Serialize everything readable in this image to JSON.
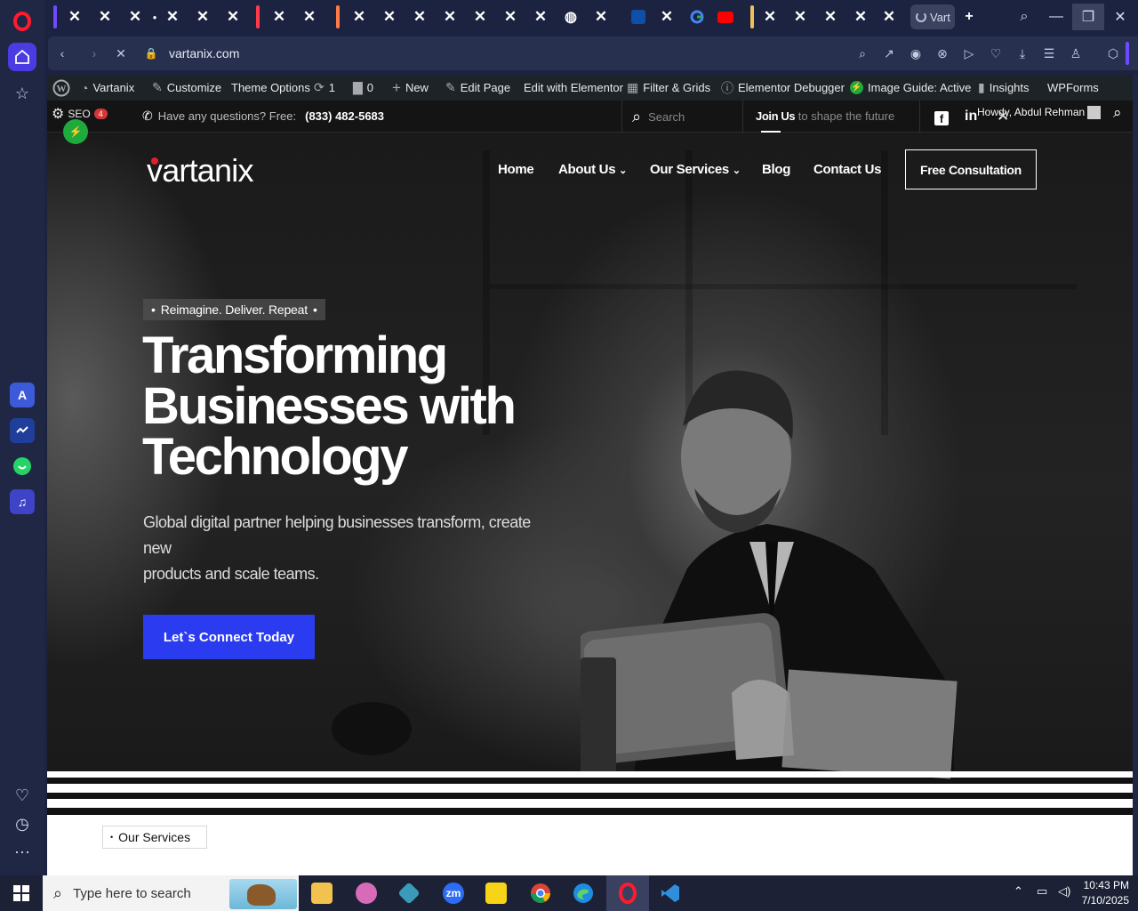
{
  "browser": {
    "url": "vartanix.com",
    "active_tab_label": "Vart",
    "sidebar_apps": [
      "aria-icon",
      "messenger-icon",
      "whatsapp-icon",
      "music-icon"
    ]
  },
  "wp_admin_bar": {
    "site_name": "Vartanix",
    "customize": "Customize",
    "theme_options": "Theme Options",
    "updates_count": "1",
    "comments_count": "0",
    "new": "New",
    "edit_page": "Edit Page",
    "edit_elementor": "Edit with Elementor",
    "filter_grids": "Filter & Grids",
    "elementor_debugger": "Elementor Debugger",
    "image_guide": "Image Guide: Active",
    "insights": "Insights",
    "wpforms": "WPForms",
    "howdy": "Howdy, Abdul Rehman",
    "seo_label": "SEO",
    "seo_badge": "4"
  },
  "top_bar": {
    "question": "Have any questions? Free:",
    "phone": "(833) 482-5683",
    "search_placeholder": "Search",
    "join_us": "Join Us",
    "join_tagline": "to shape the future"
  },
  "site_header": {
    "logo": "vartanix",
    "nav": [
      "Home",
      "About Us",
      "Our Services",
      "Blog",
      "Contact Us"
    ],
    "cta": "Free Consultation"
  },
  "hero": {
    "tagline": "Reimagine. Deliver. Repeat",
    "title_line1": "Transforming",
    "title_line2": "Businesses with",
    "title_line3": "Technology",
    "subtitle_line1": "Global digital partner helping businesses transform, create",
    "subtitle_line2": "new",
    "subtitle_line3": "products and scale teams.",
    "button": "Let`s Connect Today"
  },
  "services": {
    "label": "Our Services"
  },
  "taskbar": {
    "search_placeholder": "Type here to search",
    "time": "10:43 PM",
    "date": "7/10/2025"
  },
  "colors": {
    "brand_blue": "#2b3cf0",
    "logo_dot_red": "#e0202a",
    "opera_red": "#ff1b2d",
    "seo_green": "#1eaa3c"
  }
}
